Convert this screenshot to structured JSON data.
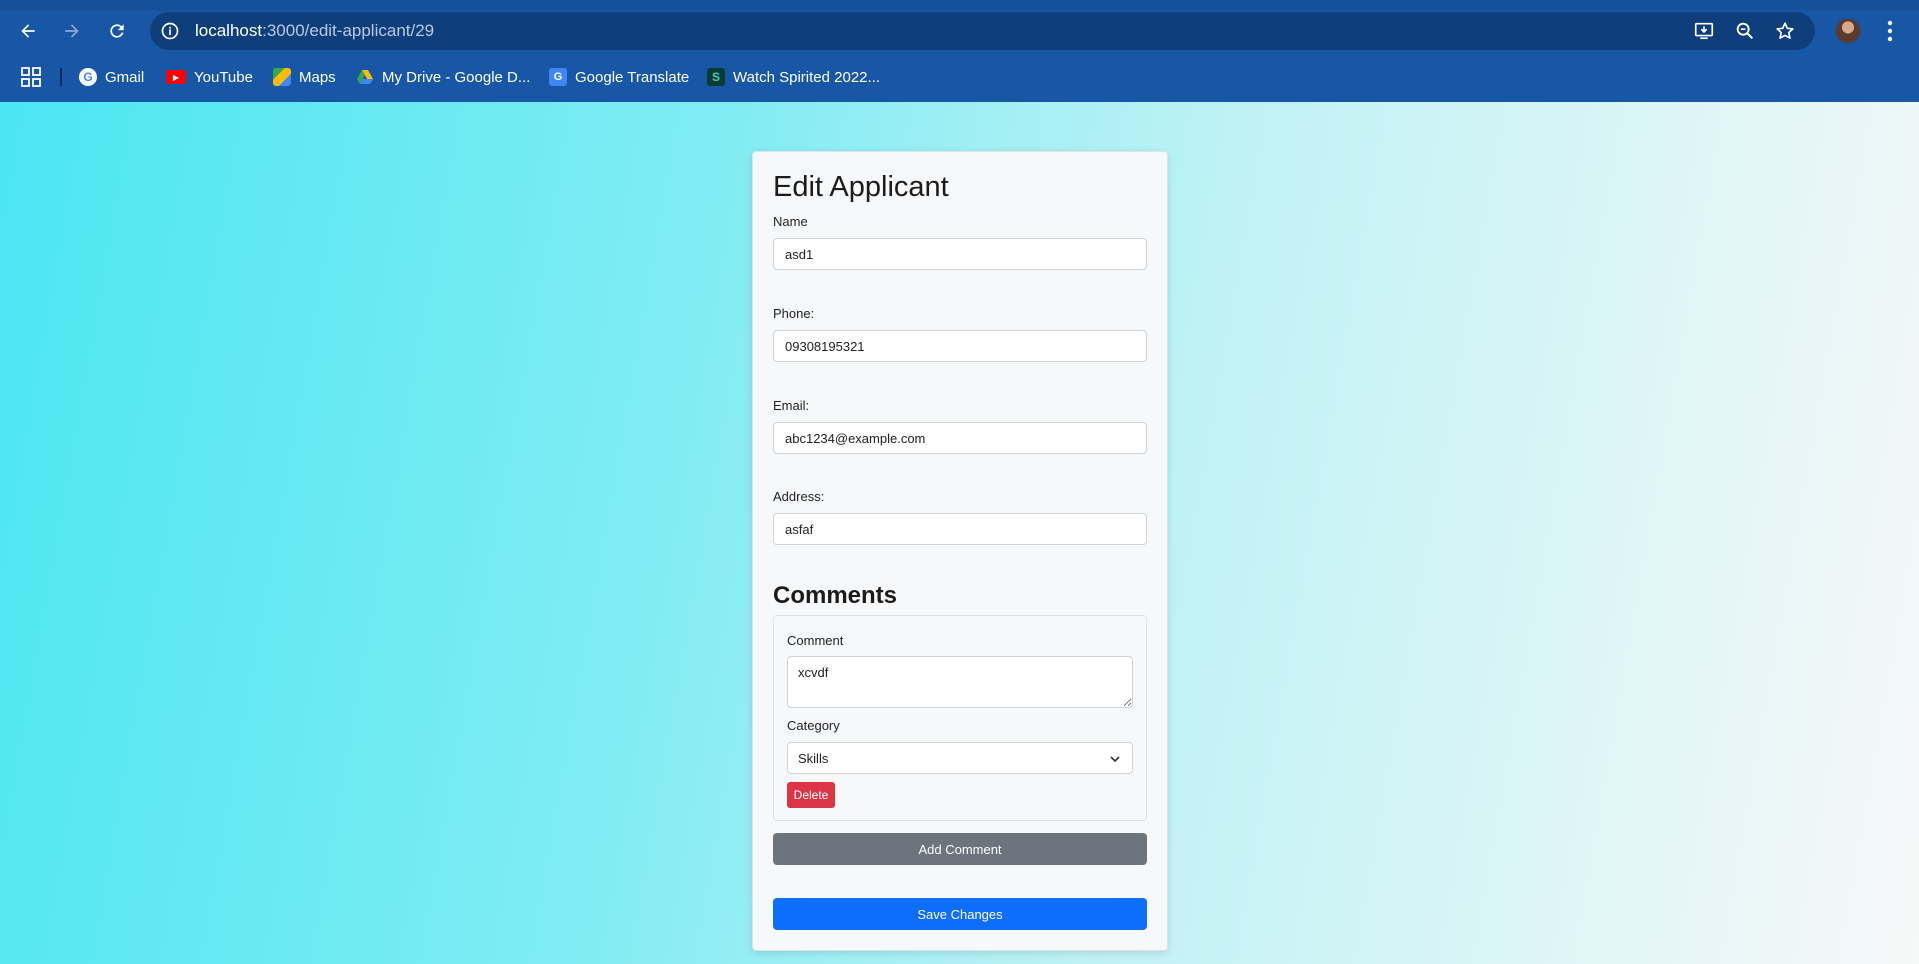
{
  "browser": {
    "url_host": "localhost",
    "url_path": ":3000/edit-applicant/29",
    "bookmarks": [
      {
        "label": "Gmail",
        "icon": "google-icon"
      },
      {
        "label": "YouTube",
        "icon": "youtube-icon"
      },
      {
        "label": "Maps",
        "icon": "maps-icon"
      },
      {
        "label": "My Drive - Google D...",
        "icon": "drive-icon"
      },
      {
        "label": "Google Translate",
        "icon": "translate-icon"
      },
      {
        "label": "Watch Spirited 2022...",
        "icon": "site-icon"
      }
    ]
  },
  "form": {
    "title": "Edit Applicant",
    "name_label": "Name",
    "name_value": "asd1",
    "phone_label": "Phone:",
    "phone_value": "09308195321",
    "email_label": "Email:",
    "email_value": "abc1234@example.com",
    "address_label": "Address:",
    "address_value": "asfaf"
  },
  "comments": {
    "heading": "Comments",
    "items": [
      {
        "comment_label": "Comment",
        "comment_value": "xcvdf",
        "category_label": "Category",
        "category_value": "Skills",
        "delete_label": "Delete"
      }
    ],
    "add_label": "Add Comment"
  },
  "actions": {
    "save_label": "Save Changes"
  },
  "colors": {
    "chrome": "#1856a6",
    "delete": "#dc3545",
    "secondary": "#6c757d",
    "primary": "#0d6efd"
  }
}
